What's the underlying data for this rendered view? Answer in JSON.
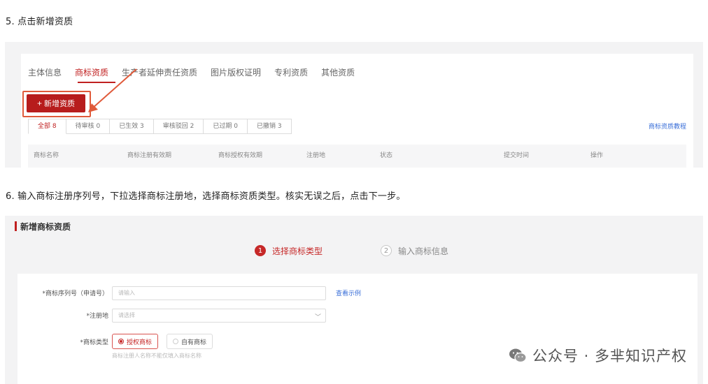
{
  "step5": {
    "text": "5. 点击新增资质"
  },
  "shot1": {
    "tabs": [
      "主体信息",
      "商标资质",
      "生产者延伸责任资质",
      "图片版权证明",
      "专利资质",
      "其他资质"
    ],
    "active_tab": 1,
    "add_button": {
      "icon": "plus-icon",
      "label": "新增资质"
    },
    "status_tabs": [
      "全部 8",
      "待审核 0",
      "已生效 3",
      "审核驳回 2",
      "已过期 0",
      "已撤销 3"
    ],
    "help_link": "商标资质教程",
    "table_headers": [
      "商标名称",
      "商标注册有效期",
      "商标授权有效期",
      "注册地",
      "状态",
      "提交时间",
      "操作"
    ],
    "colors": {
      "accent": "#c02020",
      "highlight_box": "#e05a3a"
    }
  },
  "step6": {
    "text": "6. 输入商标注册序列号，下拉选择商标注册地，选择商标资质类型。核实无误之后，点击下一步。"
  },
  "shot2": {
    "section_title": "新增商标资质",
    "steps": [
      {
        "num": "1",
        "label": "选择商标类型",
        "active": true
      },
      {
        "num": "2",
        "label": "输入商标信息",
        "active": false
      }
    ],
    "form": {
      "serial": {
        "label": "*商标序列号（申请号）",
        "placeholder": "请输入",
        "example_link": "查看示例"
      },
      "region": {
        "label": "*注册地",
        "placeholder": "请选择"
      },
      "type": {
        "label": "*商标类型",
        "options": [
          {
            "label": "授权商标",
            "selected": true
          },
          {
            "label": "自有商标",
            "selected": false
          }
        ],
        "hint": "商标注册人名称不能仅填入商标名称"
      }
    }
  },
  "watermark": {
    "text": "公众号 · 多芈知识产权",
    "icon": "wechat-icon"
  }
}
